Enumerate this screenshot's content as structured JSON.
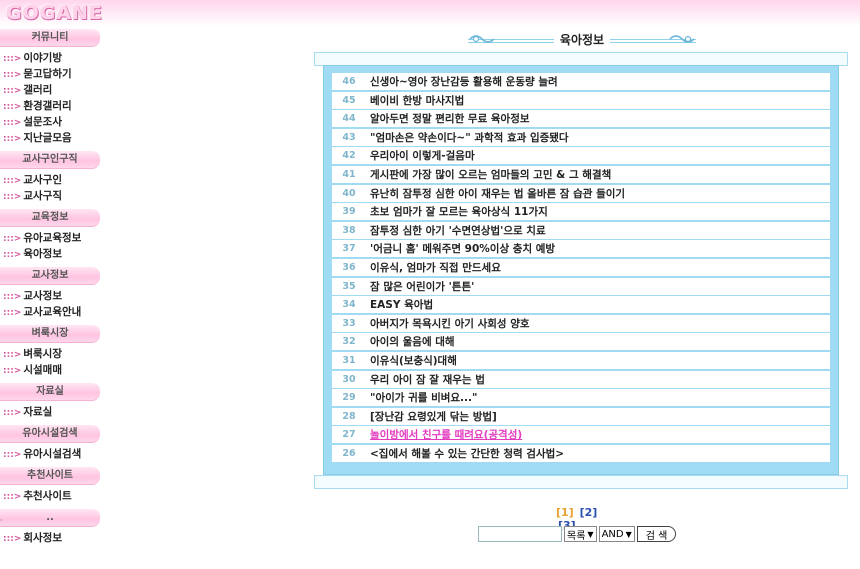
{
  "logo": "GOGANE",
  "sidebar": {
    "sections": [
      {
        "title": "커뮤니티",
        "items": [
          "이야기방",
          "묻고답하기",
          "갤러리",
          "환경갤러리",
          "설문조사",
          "지난글모음"
        ]
      },
      {
        "title": "교사구인구직",
        "items": [
          "교사구인",
          "교사구직"
        ]
      },
      {
        "title": "교육정보",
        "items": [
          "유아교육정보",
          "육아정보"
        ]
      },
      {
        "title": "교사정보",
        "items": [
          "교사정보",
          "교사교육안내"
        ]
      },
      {
        "title": "벼룩시장",
        "items": [
          "벼룩시장",
          "시설매매"
        ]
      },
      {
        "title": "자료실",
        "items": [
          "자료실"
        ]
      },
      {
        "title": "유아시설검색",
        "items": [
          "유아시설검색"
        ]
      },
      {
        "title": "추천사이트",
        "items": [
          "추천사이트"
        ]
      },
      {
        "title": "..",
        "items": [
          "회사정보"
        ]
      }
    ],
    "arrow": ":::>"
  },
  "board": {
    "title": "육아정보",
    "rows": [
      {
        "num": "46",
        "subject": "신생아~영아 장난감등 활용해 운동량 늘려"
      },
      {
        "num": "45",
        "subject": "베이비 한방 마사지법"
      },
      {
        "num": "44",
        "subject": "알아두면 정말 편리한 무료 육아정보"
      },
      {
        "num": "43",
        "subject": "\"엄마손은 약손이다~\" 과학적 효과 입증됐다"
      },
      {
        "num": "42",
        "subject": "우리아이 이렇게-걸음마"
      },
      {
        "num": "41",
        "subject": "게시판에 가장 많이 오르는 엄마들의 고민 & 그 해결책"
      },
      {
        "num": "40",
        "subject": "유난히 잠투정 심한 아이 재우는 법 올바른 잠 습관 들이기"
      },
      {
        "num": "39",
        "subject": "초보 엄마가 잘 모르는 육아상식 11가지"
      },
      {
        "num": "38",
        "subject": "잠투정 심한 아기 '수면연상법'으로 치료"
      },
      {
        "num": "37",
        "subject": "'어금니 홈' 메워주면 90%이상 충치 예방"
      },
      {
        "num": "36",
        "subject": "이유식, 엄마가 직접 만드세요"
      },
      {
        "num": "35",
        "subject": "잠 많은 어린이가 '튼튼'"
      },
      {
        "num": "34",
        "subject": "EASY 육아법"
      },
      {
        "num": "33",
        "subject": "아버지가 목욕시킨 아기 사회성 양호"
      },
      {
        "num": "32",
        "subject": "아이의 울음에 대해"
      },
      {
        "num": "31",
        "subject": "이유식(보충식)대해"
      },
      {
        "num": "30",
        "subject": "우리 아이 잠 잘 재우는 법"
      },
      {
        "num": "29",
        "subject": "\"아이가 귀를 비벼요...\""
      },
      {
        "num": "28",
        "subject": "[장난감 요령있게 닦는 방법]"
      },
      {
        "num": "27",
        "subject": "놀이방에서 친구를 때려요(공격성)",
        "highlight": true
      },
      {
        "num": "26",
        "subject": "<집에서 해볼 수 있는 간단한 청력 검사법>"
      }
    ]
  },
  "pager": {
    "current": "[1]",
    "pages": [
      "[2]",
      "[3]"
    ]
  },
  "search": {
    "input_value": "",
    "field_select": "목록",
    "op_select": "AND",
    "button_label": "검 색"
  },
  "colors": {
    "accent_pink": "#d65aa0",
    "board_blue": "#9fdcf3",
    "highlight": "#e23bbf",
    "pager_current": "#e7a12f"
  }
}
